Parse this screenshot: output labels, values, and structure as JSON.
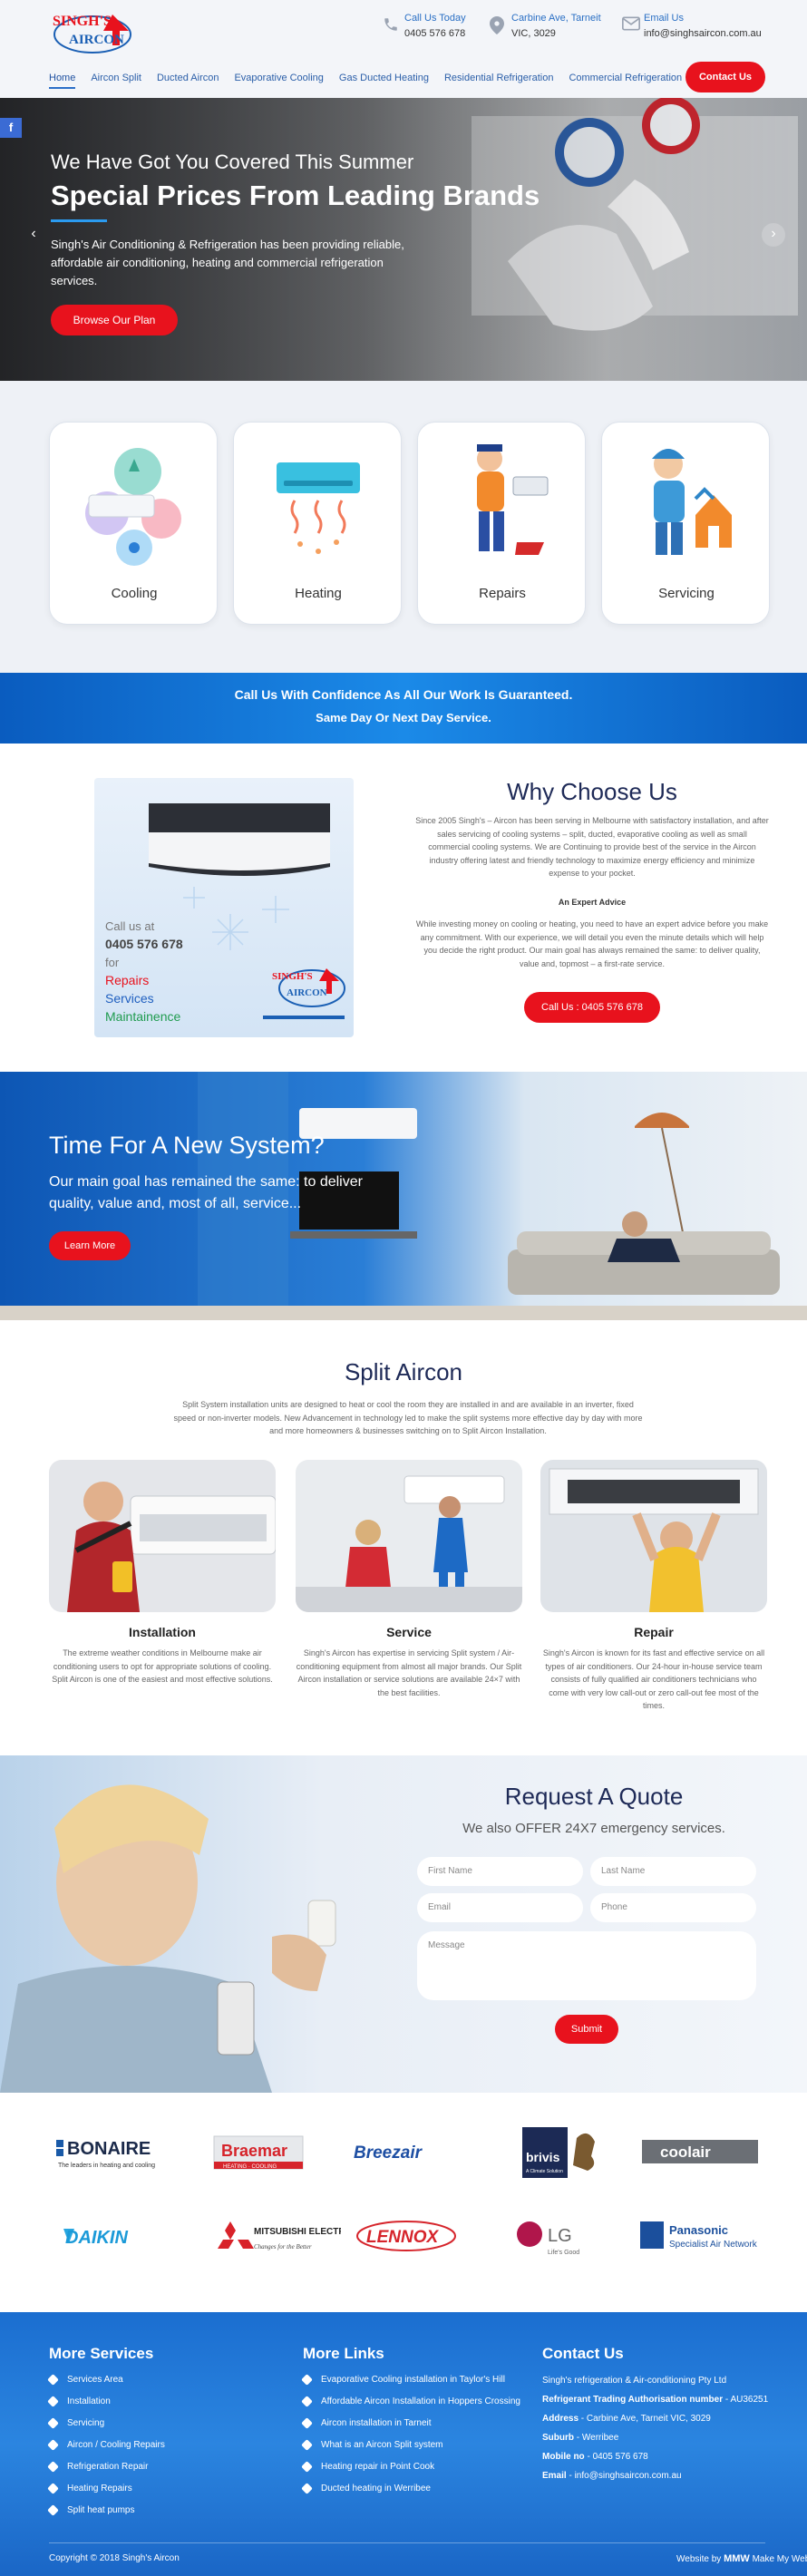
{
  "header": {
    "logo": {
      "line1": "SINGH'S",
      "line2": "AIRCON"
    },
    "phone": {
      "label": "Call Us Today",
      "value": "0405 576 678"
    },
    "address": {
      "label": "Carbine Ave, Tarneit",
      "value": "VIC, 3029"
    },
    "email": {
      "label": "Email Us",
      "value": "info@singhsaircon.com.au"
    },
    "nav": [
      "Home",
      "Aircon Split",
      "Ducted Aircon",
      "Evaporative Cooling",
      "Gas Ducted Heating",
      "Residential Refrigeration",
      "Commercial Refrigeration"
    ],
    "contact_button": "Contact Us",
    "icons": {
      "phone": "phone-icon",
      "location": "location-pin-icon",
      "email": "email-icon"
    }
  },
  "hero": {
    "subtitle": "We Have Got You Covered This Summer",
    "title": "Special Prices From Leading Brands",
    "text": "Singh's Air Conditioning & Refrigeration has been providing reliable, affordable air conditioning, heating and commercial refrigeration services.",
    "button": "Browse Our Plan",
    "facebook": "f",
    "prev": "‹",
    "next": "›"
  },
  "services": [
    {
      "title": "Cooling",
      "icon": "cooling-icon"
    },
    {
      "title": "Heating",
      "icon": "heating-icon"
    },
    {
      "title": "Repairs",
      "icon": "repairs-icon"
    },
    {
      "title": "Servicing",
      "icon": "servicing-icon"
    }
  ],
  "banner": {
    "line1": "Call Us With Confidence As All Our Work Is Guaranteed.",
    "line2": "Same Day Or Next Day Service."
  },
  "why": {
    "image": {
      "call_label": "Call us at",
      "phone": "0405 576 678",
      "for": "for",
      "items": [
        "Repairs",
        "Services",
        "Maintainence"
      ],
      "logo1": "SINGH'S",
      "logo2": "AIRCON"
    },
    "title": "Why Choose Us",
    "p1": "Since 2005 Singh's – Aircon has been serving in Melbourne with satisfactory installation, and after sales servicing of cooling systems – split, ducted, evaporative cooling as well as small commercial cooling systems. We are Continuing to provide best of the service in the Aircon industry offering latest and friendly technology to maximize energy efficiency and minimize expense to your pocket.",
    "subheading": "An Expert Advice",
    "p2": "While investing money on cooling or heating, you need to have an expert advice before you make any commitment. With our experience, we will detail you even the minute details which will help you decide the right product. Our main goal has always remained the same: to deliver quality, value and, topmost – a first-rate service.",
    "button": "Call Us : 0405 576 678"
  },
  "new_system": {
    "title": "Time For A New System?",
    "text": "Our main goal has remained the same: to deliver quality, value and, most of all, service...",
    "button": "Learn More"
  },
  "split": {
    "title": "Split Aircon",
    "desc": "Split System installation units are designed to heat or cool the room they are installed in and are available in an inverter, fixed speed or non-inverter models. New Advancement in technology led to make the split systems more effective day by day with more and more homeowners & businesses switching on to Split Aircon Installation.",
    "items": [
      {
        "title": "Installation",
        "text": "The extreme weather conditions in Melbourne make air conditioning users to opt for appropriate solutions of cooling. Split Aircon is one of the easiest and most effective solutions."
      },
      {
        "title": "Service",
        "text": "Singh's Aircon has expertise in servicing Split system / Air-conditioning equipment from almost all major brands. Our Split Aircon installation or service solutions are available 24×7 with the best facilities."
      },
      {
        "title": "Repair",
        "text": "Singh's Aircon is known for its fast and effective service on all types of air conditioners. Our 24-hour in-house service team consists of fully qualified air conditioners technicians who come with very low call-out or zero call-out fee most of the times."
      }
    ]
  },
  "quote": {
    "title": "Request A Quote",
    "subtitle": "We also OFFER 24X7 emergency services.",
    "first_name": "First Name",
    "last_name": "Last Name",
    "email": "Email",
    "phone": "Phone",
    "message": "Message",
    "button": "Submit"
  },
  "brands": [
    {
      "name": "BONAIRE",
      "tag": "The leaders in heating and cooling"
    },
    {
      "name": "Braemar",
      "tag": "HEATING · COOLING"
    },
    {
      "name": "Breezair",
      "tag": ""
    },
    {
      "name": "brivis",
      "tag": "A Climate Solution"
    },
    {
      "name": "coolair",
      "tag": ""
    },
    {
      "name": "DAIKIN",
      "tag": ""
    },
    {
      "name": "MITSUBISHI ELECTRIC",
      "tag": "Changes for the Better"
    },
    {
      "name": "LENNOX",
      "tag": ""
    },
    {
      "name": "LG",
      "tag": "Life's Good"
    },
    {
      "name": "Panasonic",
      "tag": "Specialist Air Network"
    }
  ],
  "footer": {
    "services_title": "More Services",
    "services": [
      "Services Area",
      "Installation",
      "Servicing",
      "Aircon / Cooling Repairs",
      "Refrigeration Repair",
      "Heating Repairs",
      "Split heat pumps"
    ],
    "links_title": "More Links",
    "links": [
      "Evaporative Cooling installation in Taylor's Hill",
      "Affordable Aircon Installation in Hoppers Crossing",
      "Aircon installation in Tarneit",
      "What is an Aircon Split system",
      "Heating repair in Point Cook",
      "Ducted heating in Werribee"
    ],
    "contact_title": "Contact Us",
    "company": "Singh's refrigeration & Air-conditioning Pty Ltd",
    "contact_rows": [
      {
        "label": "Refrigerant Trading Authorisation number",
        "value": "AU36251"
      },
      {
        "label": "Address",
        "value": "Carbine Ave, Tarneit VIC, 3029"
      },
      {
        "label": "Suburb",
        "value": "Werribee"
      },
      {
        "label": "Mobile no",
        "value": "0405 576 678"
      },
      {
        "label": "Email",
        "value": "info@singhsaircon.com.au"
      }
    ],
    "copyright": "Copyright © 2018 Singh's Aircon",
    "made_by": "Website by",
    "made_by_brand": "Make My Website"
  },
  "colors": {
    "accent": "#e8121d",
    "navy": "#1e2a57",
    "blue": "#1b78dc"
  }
}
